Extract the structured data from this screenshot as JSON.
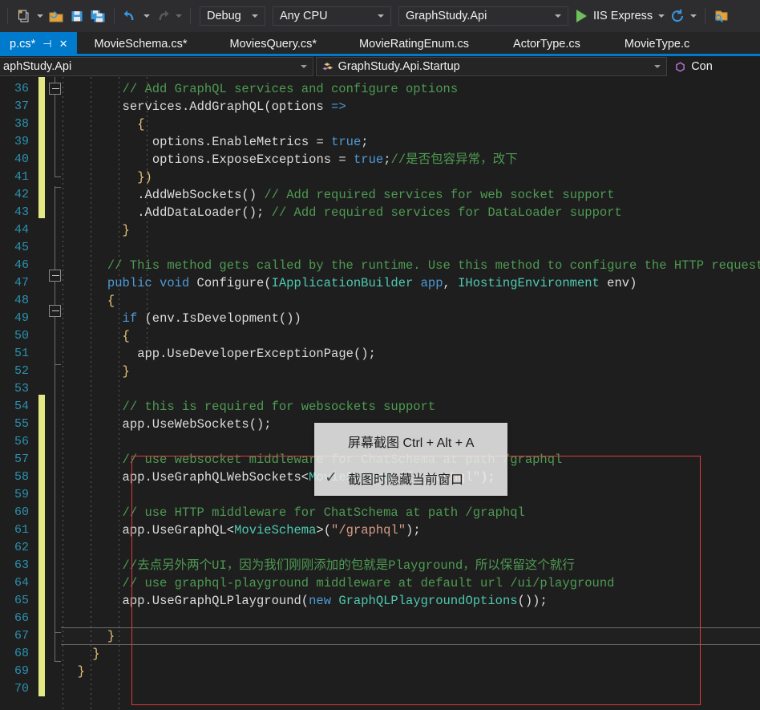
{
  "toolbar": {
    "icons": [
      {
        "name": "new-project-icon",
        "glyph": "✳"
      },
      {
        "name": "open-file-icon",
        "glyph": "📂"
      },
      {
        "name": "save-icon",
        "glyph": "💾"
      },
      {
        "name": "save-all-icon",
        "glyph": "💾"
      },
      {
        "name": "undo-icon",
        "glyph": "↺"
      },
      {
        "name": "redo-icon",
        "glyph": "↻"
      }
    ],
    "configuration": "Debug",
    "platform": "Any CPU",
    "startup_project": "GraphStudy.Api",
    "run_label": "IIS Express",
    "refresh_glyph": "⟳",
    "search_icon_name": "search-folder-icon"
  },
  "tabs": [
    {
      "label": "p.cs*",
      "active": true,
      "pin": "⊣",
      "close": "✕"
    },
    {
      "label": "MovieSchema.cs*",
      "active": false
    },
    {
      "label": "MoviesQuery.cs*",
      "active": false
    },
    {
      "label": "MovieRatingEnum.cs",
      "active": false
    },
    {
      "label": "ActorType.cs",
      "active": false
    },
    {
      "label": "MovieType.c",
      "active": false
    }
  ],
  "navbar": {
    "namespace": "aphStudy.Api",
    "type": "GraphStudy.Api.Startup",
    "member": "Con"
  },
  "editor": {
    "first_line": 36,
    "last_line": 70,
    "accent_red": "#e03a3a",
    "change_bar_color": "#e2e884",
    "lines": [
      {
        "n": 36,
        "indent": 8,
        "tokens": [
          {
            "c": "cm",
            "t": "// Add GraphQL services and configure options"
          }
        ]
      },
      {
        "n": 37,
        "indent": 8,
        "tokens": [
          {
            "c": "id",
            "t": "services."
          },
          {
            "c": "id",
            "t": "AddGraphQL"
          },
          {
            "c": "pn",
            "t": "("
          },
          {
            "c": "id",
            "t": "options "
          },
          {
            "c": "kw",
            "t": "=>"
          }
        ]
      },
      {
        "n": 38,
        "indent": 10,
        "tokens": [
          {
            "c": "br1",
            "t": "{"
          }
        ]
      },
      {
        "n": 39,
        "indent": 12,
        "tokens": [
          {
            "c": "id",
            "t": "options."
          },
          {
            "c": "id",
            "t": "EnableMetrics"
          },
          {
            "c": "pn",
            "t": " = "
          },
          {
            "c": "kw",
            "t": "true"
          },
          {
            "c": "pn",
            "t": ";"
          }
        ]
      },
      {
        "n": 40,
        "indent": 12,
        "tokens": [
          {
            "c": "id",
            "t": "options."
          },
          {
            "c": "id",
            "t": "ExposeExceptions"
          },
          {
            "c": "pn",
            "t": " = "
          },
          {
            "c": "kw",
            "t": "true"
          },
          {
            "c": "pn",
            "t": ";"
          },
          {
            "c": "cm",
            "t": "//是否包容异常，改下"
          }
        ]
      },
      {
        "n": 41,
        "indent": 10,
        "tokens": [
          {
            "c": "br1",
            "t": "})"
          }
        ]
      },
      {
        "n": 42,
        "indent": 10,
        "tokens": [
          {
            "c": "pn",
            "t": "."
          },
          {
            "c": "id",
            "t": "AddWebSockets"
          },
          {
            "c": "pn",
            "t": "() "
          },
          {
            "c": "cm",
            "t": "// Add required services for web socket support"
          }
        ]
      },
      {
        "n": 43,
        "indent": 10,
        "tokens": [
          {
            "c": "pn",
            "t": "."
          },
          {
            "c": "id",
            "t": "AddDataLoader"
          },
          {
            "c": "pn",
            "t": "(); "
          },
          {
            "c": "cm",
            "t": "// Add required services for DataLoader support"
          }
        ]
      },
      {
        "n": 44,
        "indent": 8,
        "tokens": [
          {
            "c": "br1",
            "t": "}"
          }
        ]
      },
      {
        "n": 45,
        "indent": 0,
        "tokens": []
      },
      {
        "n": 46,
        "indent": 6,
        "tokens": [
          {
            "c": "cm",
            "t": "// This method gets called by the runtime. Use this method to configure the HTTP request p"
          }
        ]
      },
      {
        "n": 47,
        "indent": 6,
        "tokens": [
          {
            "c": "kw",
            "t": "public void"
          },
          {
            "c": "id",
            "t": " Configure"
          },
          {
            "c": "pn",
            "t": "("
          },
          {
            "c": "ty",
            "t": "IApplicationBuilder"
          },
          {
            "c": "kw",
            "t": " app"
          },
          {
            "c": "pn",
            "t": ", "
          },
          {
            "c": "ty",
            "t": "IHostingEnvironment"
          },
          {
            "c": "id",
            "t": " env"
          },
          {
            "c": "pn",
            "t": ")"
          }
        ]
      },
      {
        "n": 48,
        "indent": 6,
        "tokens": [
          {
            "c": "br1",
            "t": "{"
          }
        ]
      },
      {
        "n": 49,
        "indent": 8,
        "tokens": [
          {
            "c": "kw",
            "t": "if"
          },
          {
            "c": "pn",
            "t": " ("
          },
          {
            "c": "id",
            "t": "env."
          },
          {
            "c": "id",
            "t": "IsDevelopment"
          },
          {
            "c": "pn",
            "t": "())"
          }
        ]
      },
      {
        "n": 50,
        "indent": 8,
        "tokens": [
          {
            "c": "br1",
            "t": "{"
          }
        ]
      },
      {
        "n": 51,
        "indent": 10,
        "tokens": [
          {
            "c": "id",
            "t": "app."
          },
          {
            "c": "id",
            "t": "UseDeveloperExceptionPage"
          },
          {
            "c": "pn",
            "t": "();"
          }
        ]
      },
      {
        "n": 52,
        "indent": 8,
        "tokens": [
          {
            "c": "br1",
            "t": "}"
          }
        ]
      },
      {
        "n": 53,
        "indent": 0,
        "tokens": []
      },
      {
        "n": 54,
        "indent": 8,
        "tokens": [
          {
            "c": "cm",
            "t": "// this is required for websockets support"
          }
        ]
      },
      {
        "n": 55,
        "indent": 8,
        "tokens": [
          {
            "c": "id",
            "t": "app."
          },
          {
            "c": "id",
            "t": "UseWebSockets"
          },
          {
            "c": "pn",
            "t": "();"
          }
        ]
      },
      {
        "n": 56,
        "indent": 0,
        "tokens": []
      },
      {
        "n": 57,
        "indent": 8,
        "tokens": [
          {
            "c": "cm",
            "t": "// use websocket middleware for ChatSchema at path /graphql"
          }
        ]
      },
      {
        "n": 58,
        "indent": 8,
        "tokens": [
          {
            "c": "id",
            "t": "app."
          },
          {
            "c": "id",
            "t": "UseGraphQLWebSockets"
          },
          {
            "c": "pn",
            "t": "<"
          },
          {
            "c": "ty",
            "t": "MovieSchema"
          },
          {
            "c": "pn",
            "t": ">("
          },
          {
            "c": "st",
            "t": "\"/graphql\""
          },
          {
            "c": "pn",
            "t": ");"
          }
        ]
      },
      {
        "n": 59,
        "indent": 0,
        "tokens": []
      },
      {
        "n": 60,
        "indent": 8,
        "tokens": [
          {
            "c": "cm",
            "t": "// use HTTP middleware for ChatSchema at path /graphql"
          }
        ]
      },
      {
        "n": 61,
        "indent": 8,
        "tokens": [
          {
            "c": "id",
            "t": "app."
          },
          {
            "c": "id",
            "t": "UseGraphQL"
          },
          {
            "c": "pn",
            "t": "<"
          },
          {
            "c": "ty",
            "t": "MovieSchema"
          },
          {
            "c": "pn",
            "t": ">("
          },
          {
            "c": "st",
            "t": "\"/graphql\""
          },
          {
            "c": "pn",
            "t": ");"
          }
        ]
      },
      {
        "n": 62,
        "indent": 0,
        "tokens": []
      },
      {
        "n": 63,
        "indent": 8,
        "tokens": [
          {
            "c": "cm",
            "t": "//去点另外两个UI，因为我们刚刚添加的包就是Playground，所以保留这个就行"
          }
        ]
      },
      {
        "n": 64,
        "indent": 8,
        "tokens": [
          {
            "c": "cm",
            "t": "// use graphql-playground middleware at default url /ui/playground"
          }
        ]
      },
      {
        "n": 65,
        "indent": 8,
        "tokens": [
          {
            "c": "id",
            "t": "app."
          },
          {
            "c": "id",
            "t": "UseGraphQLPlayground"
          },
          {
            "c": "pn",
            "t": "("
          },
          {
            "c": "kw",
            "t": "new"
          },
          {
            "c": "ty",
            "t": " GraphQLPlaygroundOptions"
          },
          {
            "c": "pn",
            "t": "());"
          }
        ]
      },
      {
        "n": 66,
        "indent": 0,
        "tokens": []
      },
      {
        "n": 67,
        "indent": 6,
        "tokens": [
          {
            "c": "br1",
            "t": "}"
          }
        ]
      },
      {
        "n": 68,
        "indent": 4,
        "tokens": [
          {
            "c": "br1",
            "t": "}"
          }
        ]
      },
      {
        "n": 69,
        "indent": 2,
        "tokens": [
          {
            "c": "br1",
            "t": "}"
          }
        ]
      },
      {
        "n": 70,
        "indent": 0,
        "tokens": []
      }
    ]
  },
  "popup": {
    "item1_label": "屏幕截图 Ctrl + Alt + A",
    "item2_label": "截图时隐藏当前窗口",
    "item2_check": "✓"
  }
}
